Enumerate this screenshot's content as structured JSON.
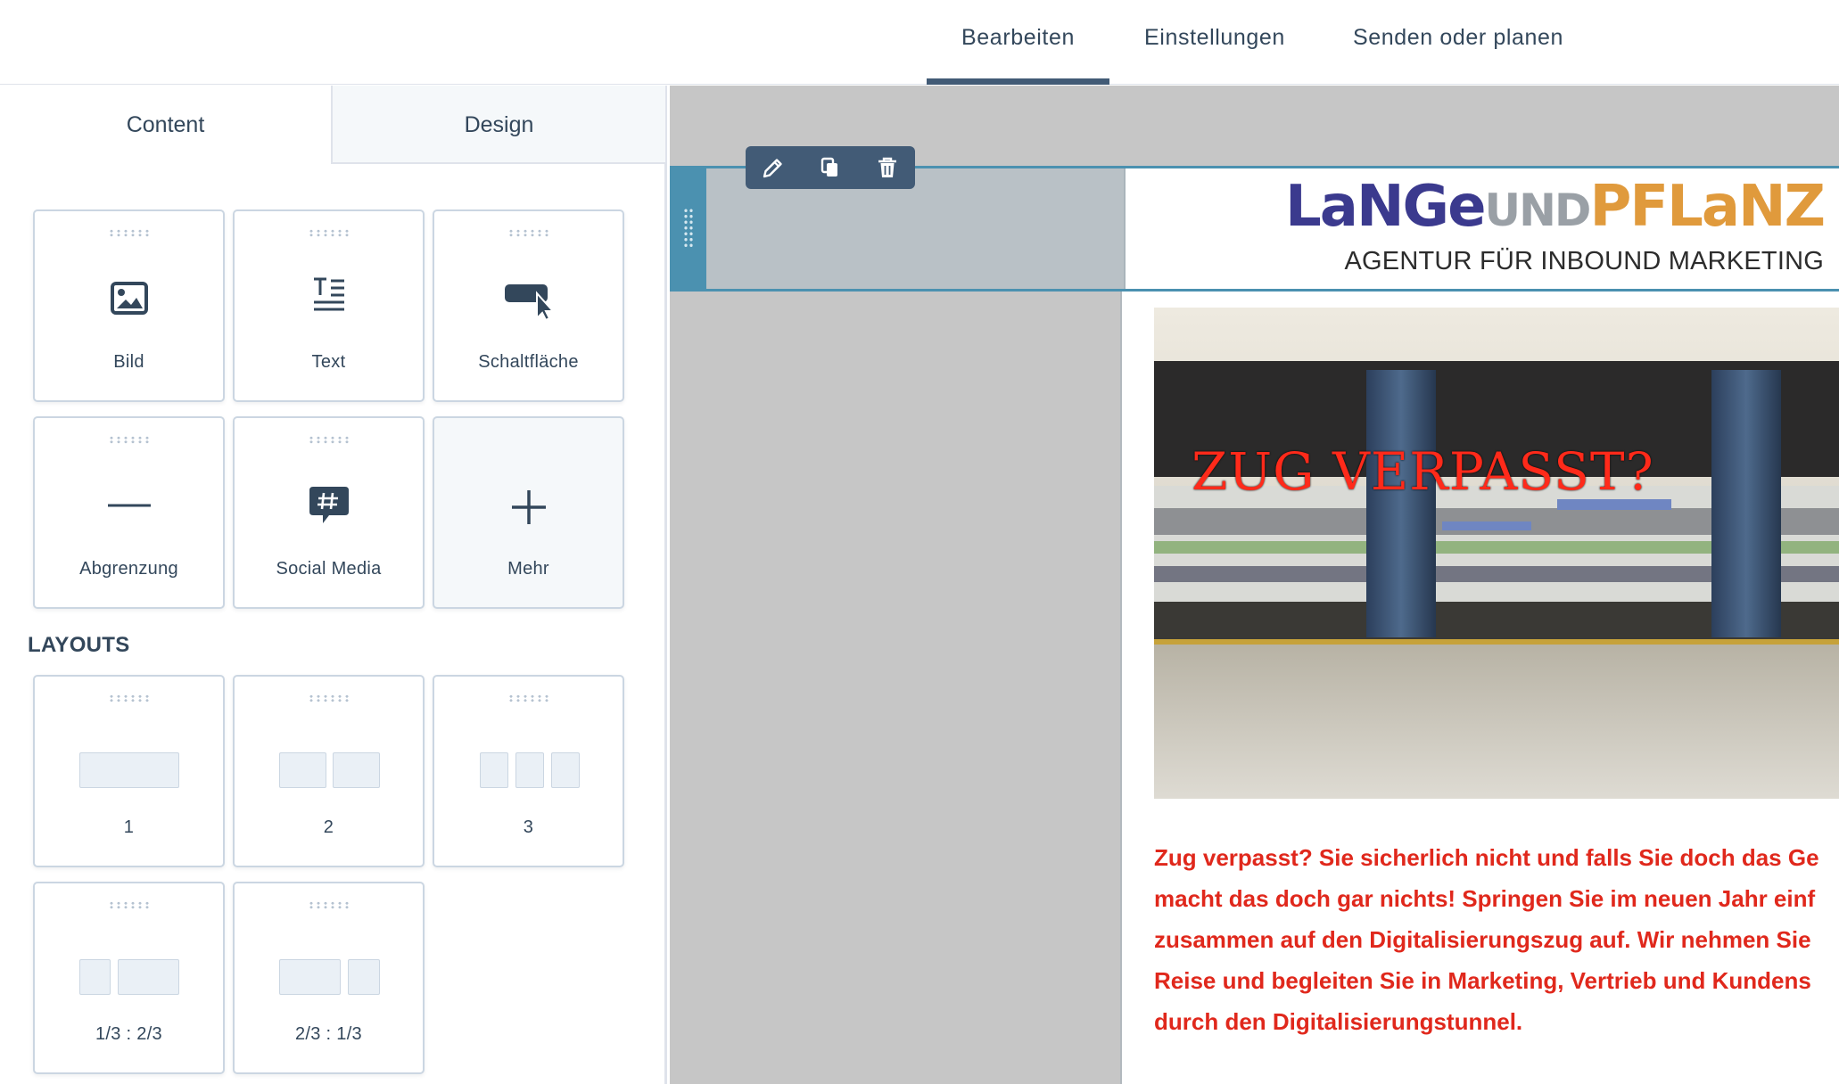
{
  "top_nav": {
    "tabs": [
      {
        "label": "Bearbeiten",
        "active": true
      },
      {
        "label": "Einstellungen",
        "active": false
      },
      {
        "label": "Senden oder planen",
        "active": false
      }
    ]
  },
  "sidebar": {
    "tabs": [
      {
        "label": "Content",
        "active": true
      },
      {
        "label": "Design",
        "active": false
      }
    ],
    "modules": [
      {
        "label": "Bild",
        "icon": "image-icon"
      },
      {
        "label": "Text",
        "icon": "text-icon"
      },
      {
        "label": "Schaltfläche",
        "icon": "button-cursor-icon"
      },
      {
        "label": "Abgrenzung",
        "icon": "divider-icon"
      },
      {
        "label": "Social Media",
        "icon": "social-hashtag-icon"
      },
      {
        "label": "Mehr",
        "icon": "plus-icon"
      }
    ],
    "layouts_heading": "LAYOUTS",
    "layouts": [
      {
        "label": "1"
      },
      {
        "label": "2"
      },
      {
        "label": "3"
      },
      {
        "label": "1/3 : 2/3"
      },
      {
        "label": "2/3 : 1/3"
      }
    ]
  },
  "editor": {
    "toolbar_icons": [
      "pencil-icon",
      "duplicate-icon",
      "trash-icon"
    ],
    "header": {
      "logo_parts": [
        "LaNGe",
        "UND",
        "PFLaNZ"
      ],
      "tagline": "AGENTUR FÜR INBOUND MARKETING"
    },
    "hero_caption": "ZUG VERPASST?",
    "body_lines": [
      "Zug verpasst? Sie sicherlich nicht und falls Sie doch das Ge",
      "macht das doch gar nichts! Springen Sie im neuen Jahr einf",
      "zusammen auf den Digitalisierungszug auf. Wir nehmen Sie",
      "Reise und begleiten Sie in Marketing, Vertrieb und Kundens",
      "durch den Digitalisierungstunnel."
    ]
  },
  "colors": {
    "nav_active": "#425b76",
    "row_highlight": "#4b91b0",
    "body_text": "#e0281c",
    "canvas": "#c6c6c6"
  }
}
